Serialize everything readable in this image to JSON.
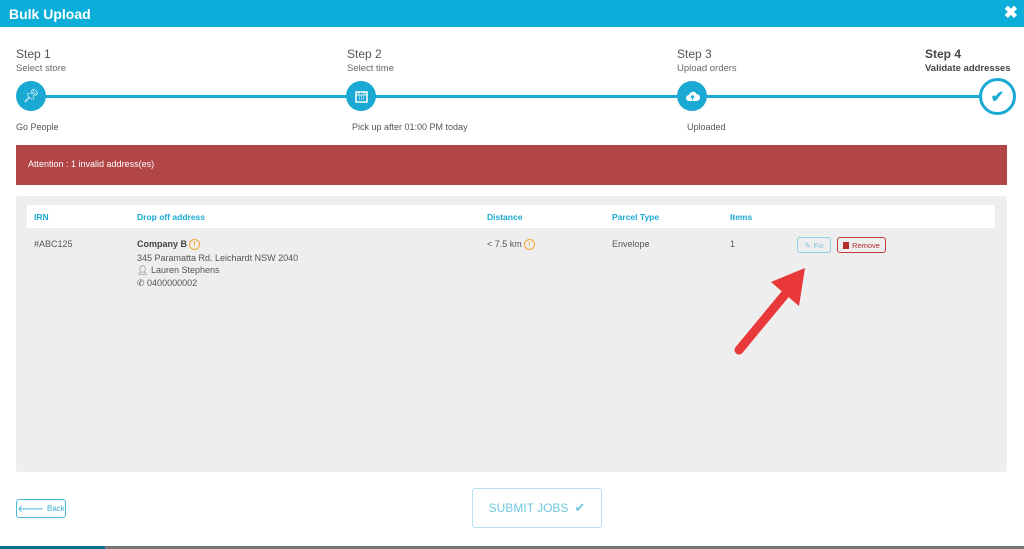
{
  "header": {
    "title": "Bulk Upload",
    "close_icon": "close-icon"
  },
  "steps": [
    {
      "step": "Step 1",
      "label": "Select store",
      "value": "Go People",
      "icon": "pin-icon"
    },
    {
      "step": "Step 2",
      "label": "Select time",
      "value": "Pick up after 01:00 PM today",
      "icon": "calendar-icon"
    },
    {
      "step": "Step 3",
      "label": "Upload orders",
      "value": "Uploaded",
      "icon": "cloud-upload-icon"
    },
    {
      "step": "Step 4",
      "label": "Validate addresses",
      "icon": "check-icon",
      "active": true
    }
  ],
  "alert": {
    "text": "Attention : 1 invalid address(es)",
    "color": "#b24545"
  },
  "table": {
    "columns": [
      "IRN",
      "Drop off address",
      "Distance",
      "Parcel Type",
      "Items"
    ],
    "rows": [
      {
        "irn": "#ABC125",
        "company": "Company B",
        "address": "345 Paramatta Rd. Leichardt NSW 2040",
        "contact": "Lauren Stephens",
        "phone": "0400000002",
        "distance": "< 7.5 km",
        "parcel_type": "Envelope",
        "items": "1",
        "fix_label": "Fix",
        "remove_label": "Remove"
      }
    ]
  },
  "footer": {
    "back_label": "Back",
    "submit_label": "SUBMIT JOBS"
  },
  "colors": {
    "accent": "#0aaed8",
    "danger": "#b24545",
    "annotation_arrow": "#e8383a"
  }
}
